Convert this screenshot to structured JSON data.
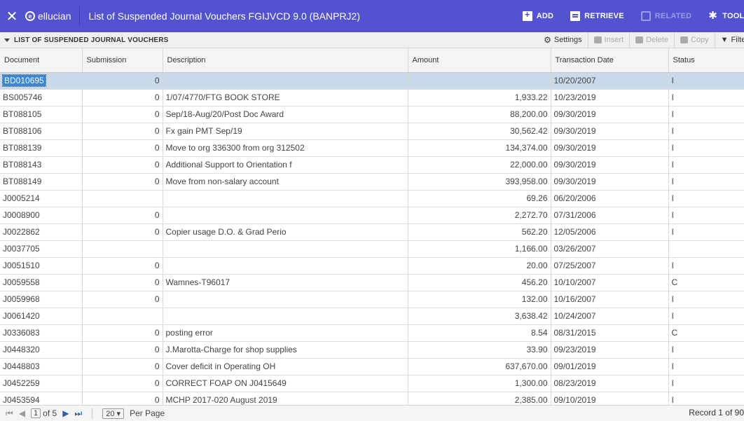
{
  "header": {
    "brand": "ellucian",
    "title": "List of Suspended Journal Vouchers FGIJVCD 9.0 (BANPRJ2)",
    "actions": [
      {
        "label": "ADD",
        "icon": "add-icon",
        "enabled": true
      },
      {
        "label": "RETRIEVE",
        "icon": "retrieve-icon",
        "enabled": true
      },
      {
        "label": "RELATED",
        "icon": "related-icon",
        "enabled": false
      },
      {
        "label": "TOOLS",
        "icon": "gear-icon",
        "enabled": true
      }
    ],
    "accent": "#5353d1"
  },
  "section": {
    "title": "LIST OF SUSPENDED JOURNAL VOUCHERS",
    "actions": [
      {
        "label": "Settings",
        "icon": "gear-icon",
        "enabled": true
      },
      {
        "label": "Insert",
        "icon": "insert-icon",
        "enabled": false
      },
      {
        "label": "Delete",
        "icon": "delete-icon",
        "enabled": false
      },
      {
        "label": "Copy",
        "icon": "copy-icon",
        "enabled": false
      },
      {
        "label": "Filter",
        "icon": "filter-icon",
        "enabled": true
      }
    ]
  },
  "table": {
    "columns": [
      "Document",
      "Submission",
      "Description",
      "Amount",
      "Transaction Date",
      "Status"
    ],
    "rows": [
      {
        "doc": "BD010695",
        "sub": "0",
        "desc": "",
        "amt": "",
        "date": "10/20/2007",
        "status": "I",
        "selected": true
      },
      {
        "doc": "BS005746",
        "sub": "0",
        "desc": "1/07/4770/FTG BOOK STORE",
        "amt": "1,933.22",
        "date": "10/23/2019",
        "status": "I"
      },
      {
        "doc": "BT088105",
        "sub": "0",
        "desc": "Sep/18-Aug/20/Post Doc Award",
        "amt": "88,200.00",
        "date": "09/30/2019",
        "status": "I"
      },
      {
        "doc": "BT088106",
        "sub": "0",
        "desc": "Fx gain PMT Sep/19",
        "amt": "30,562.42",
        "date": "09/30/2019",
        "status": "I"
      },
      {
        "doc": "BT088139",
        "sub": "0",
        "desc": "Move to org 336300 from org 312502",
        "amt": "134,374.00",
        "date": "09/30/2019",
        "status": "I"
      },
      {
        "doc": "BT088143",
        "sub": "0",
        "desc": "Additional Support to Orientation f",
        "amt": "22,000.00",
        "date": "09/30/2019",
        "status": "I"
      },
      {
        "doc": "BT088149",
        "sub": "0",
        "desc": "Move from non-salary account",
        "amt": "393,958.00",
        "date": "09/30/2019",
        "status": "I"
      },
      {
        "doc": "J0005214",
        "sub": "",
        "desc": "",
        "amt": "69.26",
        "date": "06/20/2006",
        "status": "I"
      },
      {
        "doc": "J0008900",
        "sub": "0",
        "desc": "",
        "amt": "2,272.70",
        "date": "07/31/2006",
        "status": "I"
      },
      {
        "doc": "J0022862",
        "sub": "0",
        "desc": "Copier usage D.O. & Grad Perio",
        "amt": "562.20",
        "date": "12/05/2006",
        "status": "I"
      },
      {
        "doc": "J0037705",
        "sub": "",
        "desc": "",
        "amt": "1,166.00",
        "date": "03/26/2007",
        "status": ""
      },
      {
        "doc": "J0051510",
        "sub": "0",
        "desc": "",
        "amt": "20.00",
        "date": "07/25/2007",
        "status": "I"
      },
      {
        "doc": "J0059558",
        "sub": "0",
        "desc": "Wamnes-T96017",
        "amt": "456.20",
        "date": "10/10/2007",
        "status": "C"
      },
      {
        "doc": "J0059968",
        "sub": "0",
        "desc": "",
        "amt": "132.00",
        "date": "10/16/2007",
        "status": "I"
      },
      {
        "doc": "J0061420",
        "sub": "",
        "desc": "",
        "amt": "3,638.42",
        "date": "10/24/2007",
        "status": "I"
      },
      {
        "doc": "J0336083",
        "sub": "0",
        "desc": "posting error",
        "amt": "8.54",
        "date": "08/31/2015",
        "status": "C"
      },
      {
        "doc": "J0448320",
        "sub": "0",
        "desc": "J.Marotta-Charge for shop supplies",
        "amt": "33.90",
        "date": "09/23/2019",
        "status": "I"
      },
      {
        "doc": "J0448803",
        "sub": "0",
        "desc": "Cover deficit in Operating OH",
        "amt": "637,670.00",
        "date": "09/01/2019",
        "status": "I"
      },
      {
        "doc": "J0452259",
        "sub": "0",
        "desc": "CORRECT FOAP ON J0415649",
        "amt": "1,300.00",
        "date": "08/23/2019",
        "status": "I"
      },
      {
        "doc": "J0453594",
        "sub": "0",
        "desc": "MCHP 2017-020 August 2019",
        "amt": "2,385.00",
        "date": "09/10/2019",
        "status": "I"
      }
    ]
  },
  "footer": {
    "page": "1",
    "of_label": "of 5",
    "per_page": "20",
    "per_page_label": "Per Page",
    "record": "Record 1 of 90"
  }
}
